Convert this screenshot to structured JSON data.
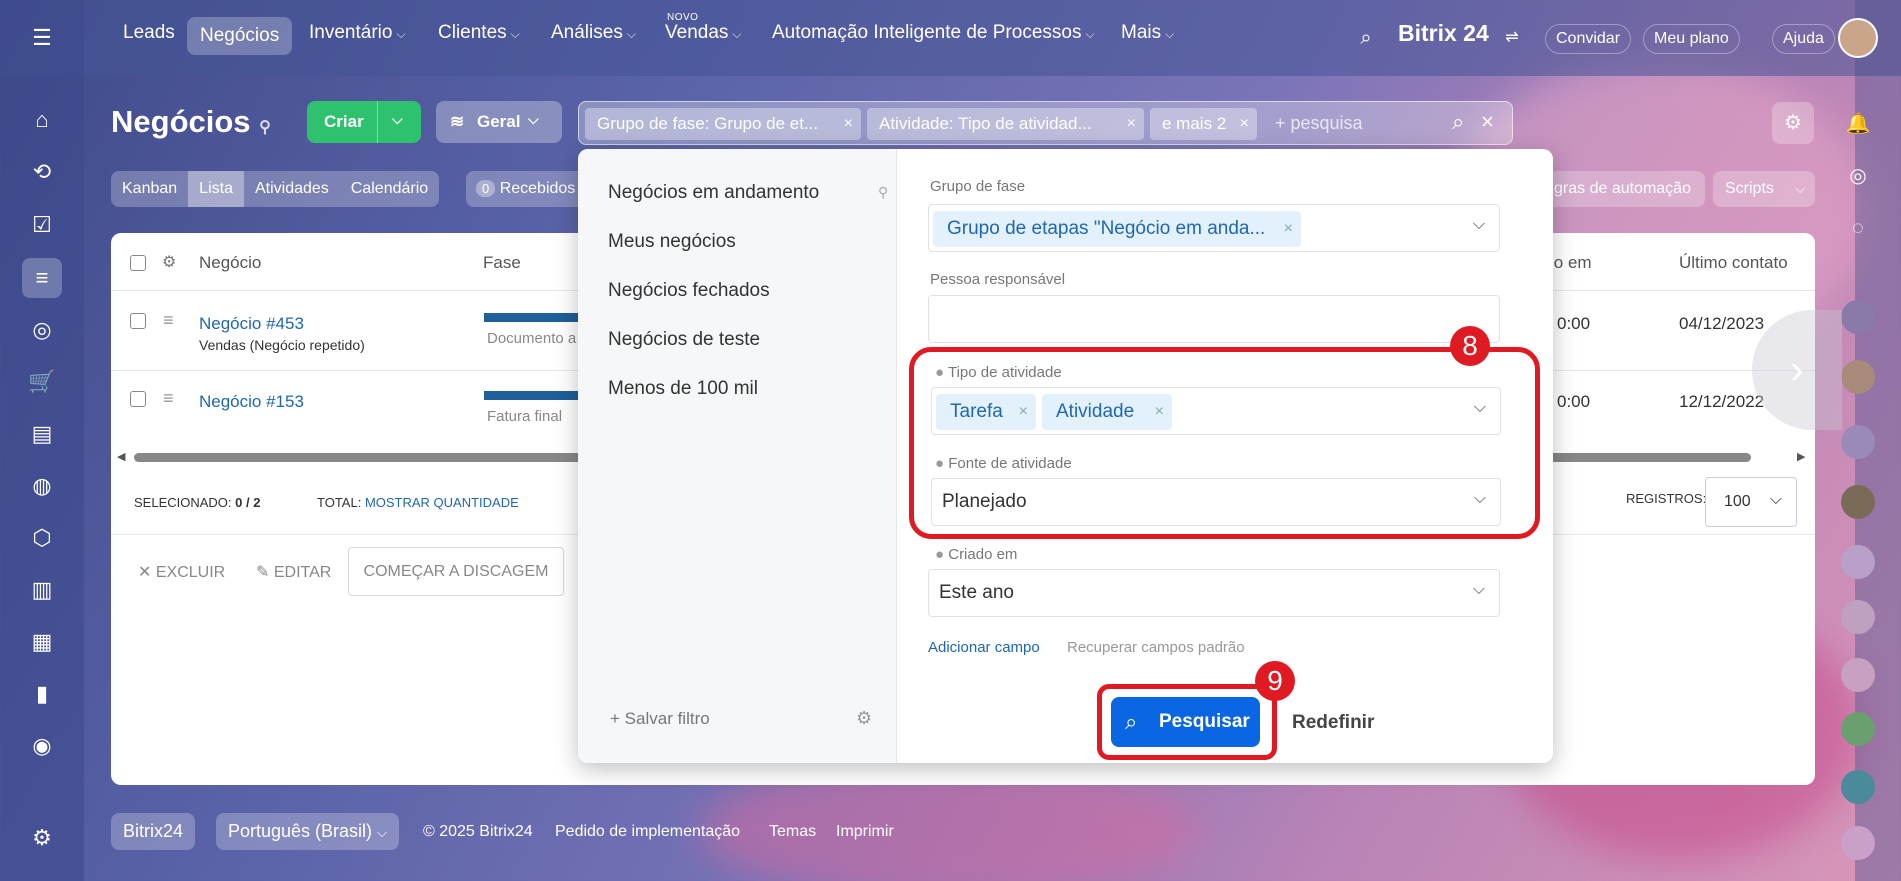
{
  "topnav": {
    "items": [
      {
        "label": "Leads",
        "chev": ""
      },
      {
        "label": "Negócios",
        "chev": "",
        "active": true
      },
      {
        "label": "Inventário",
        "chev": "⌵"
      },
      {
        "label": "Clientes",
        "chev": "⌵"
      },
      {
        "label": "Análises",
        "chev": "⌵"
      },
      {
        "label": "Vendas",
        "chev": "⌵",
        "badge": "NOVO"
      },
      {
        "label": "Automação Inteligente de Processos",
        "chev": "⌵"
      },
      {
        "label": "Mais",
        "chev": "⌵"
      }
    ],
    "brand": "Bitrix 24",
    "invite": "Convidar",
    "plan": "Meu plano",
    "help": "Ajuda"
  },
  "page": {
    "title": "Negócios",
    "create": "Criar",
    "general": "Geral"
  },
  "filterbar": {
    "chips": [
      "Grupo de fase: Grupo de et...",
      "Atividade: Tipo de atividad...",
      "e mais 2"
    ],
    "placeholder": "+ pesquisa"
  },
  "viewtabs": [
    "Kanban",
    "Lista",
    "Atividades",
    "Calendário"
  ],
  "received": {
    "count": "0",
    "label": "Recebidos"
  },
  "automation": "gras de automação",
  "scripts": "Scripts",
  "table": {
    "headers": {
      "deal": "Negócio",
      "stage": "Fase",
      "created": "io em",
      "last": "Último contato"
    },
    "rows": [
      {
        "name": "Negócio #453",
        "sub": "Vendas (Negócio repetido)",
        "stage": "Documento a",
        "time": "0:00",
        "last": "04/12/2023"
      },
      {
        "name": "Negócio #153",
        "sub": "",
        "stage": "Fatura final",
        "time": "0:00",
        "last": "12/12/2022"
      }
    ]
  },
  "status": {
    "selected_label": "SELECIONADO:",
    "selected": "0 / 2",
    "total_label": "TOTAL:",
    "total_link": "MOSTRAR QUANTIDADE",
    "records_label": "REGISTROS:",
    "records": "100"
  },
  "actions": {
    "delete": "EXCLUIR",
    "edit": "EDITAR",
    "call": "COMEÇAR A DISCAGEM"
  },
  "filter": {
    "presets": [
      "Negócios em andamento",
      "Meus negócios",
      "Negócios fechados",
      "Negócios de teste",
      "Menos de 100 mil"
    ],
    "save": "Salvar filtro",
    "fields": {
      "stage_group_label": "Grupo de fase",
      "stage_group_value": "Grupo de etapas \"Negócio em anda...",
      "responsible_label": "Pessoa responsável",
      "activity_type_label": "Tipo de atividade",
      "activity_tags": [
        "Tarefa",
        "Atividade"
      ],
      "activity_source_label": "Fonte de atividade",
      "activity_source_value": "Planejado",
      "created_label": "Criado em",
      "created_value": "Este ano"
    },
    "add_field": "Adicionar campo",
    "restore": "Recuperar campos padrão",
    "search": "Pesquisar",
    "reset": "Redefinir"
  },
  "annotations": {
    "box8": "8",
    "box9": "9"
  },
  "footer": {
    "brand": "Bitrix24",
    "lang": "Português (Brasil)",
    "copy": "© 2025 Bitrix24",
    "order": "Pedido de implementação",
    "themes": "Temas",
    "print": "Imprimir"
  },
  "colors": {
    "accent": "#2067b0",
    "green": "#2fc26e",
    "red": "#e01a22",
    "search": "#0b66e4"
  }
}
